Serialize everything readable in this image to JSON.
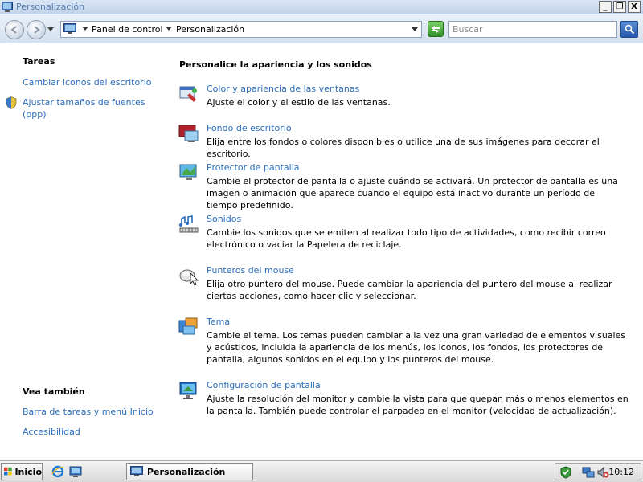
{
  "window": {
    "title": "Personalización",
    "min_label": "_",
    "max_label": "❐",
    "close_label": "X"
  },
  "address": {
    "crumbs": [
      "Panel de control",
      "Personalización"
    ],
    "search_placeholder": "Buscar"
  },
  "sidebar": {
    "tasks_title": "Tareas",
    "tasks": [
      {
        "label": "Cambiar iconos del escritorio"
      },
      {
        "label_line1": "Ajustar tamaños de fuentes",
        "label_line2": "(ppp)"
      }
    ],
    "see_also_title": "Vea también",
    "see_also": [
      {
        "label": "Barra de tareas y menú Inicio"
      },
      {
        "label": "Accesibilidad"
      }
    ]
  },
  "main": {
    "heading": "Personalice la apariencia y los sonidos",
    "items": [
      {
        "title": "Color y apariencia de las ventanas",
        "desc": "Ajuste el color y el estilo de las ventanas."
      },
      {
        "title": "Fondo de escritorio",
        "desc": "Elija entre los fondos o colores disponibles o utilice una de sus imágenes para decorar el escritorio."
      },
      {
        "title": "Protector de pantalla",
        "desc": "Cambie el protector de pantalla o ajuste cuándo se activará. Un protector de pantalla es una imagen o animación que aparece cuando el equipo está inactivo durante un período de tiempo predefinido."
      },
      {
        "title": "Sonidos",
        "desc": "Cambie los sonidos que se emiten al realizar todo tipo de actividades, como recibir correo electrónico o vaciar la Papelera de reciclaje."
      },
      {
        "title": "Punteros del mouse",
        "desc": "Elija otro puntero del mouse. Puede cambiar la apariencia del puntero del mouse al realizar ciertas acciones, como hacer clic y seleccionar."
      },
      {
        "title": "Tema",
        "desc": "Cambie el tema. Los temas pueden cambiar a la vez una gran variedad de elementos visuales y acústicos, incluida la apariencia de los menús, los iconos, los fondos, los protectores de pantalla, algunos sonidos en el equipo y los punteros del mouse."
      },
      {
        "title": "Configuración de pantalla",
        "desc": "Ajuste la resolución del monitor y cambie la vista para que quepan más o menos elementos en la pantalla. También puede controlar el parpadeo en el monitor (velocidad de actualización)."
      }
    ]
  },
  "taskbar": {
    "start_label": "Inicio",
    "active_window": "Personalización",
    "clock": "10:12"
  },
  "colors": {
    "link": "#2a6ebc",
    "title_text": "#5a7fb3"
  }
}
